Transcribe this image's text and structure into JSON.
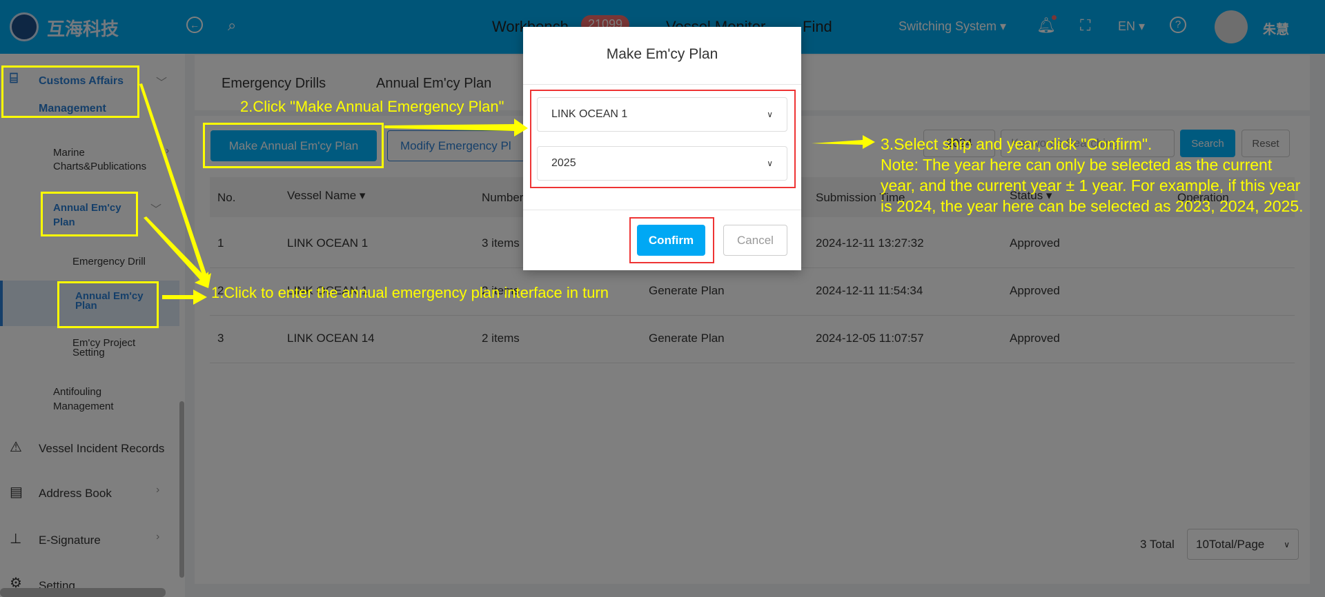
{
  "header": {
    "logo_text": "互海科技",
    "nav": [
      "Workbench",
      "Vessel Monitor",
      "Find"
    ],
    "badge": "21099",
    "switching": "Switching System ▾",
    "lang": "EN ▾",
    "user": "朱慧",
    "icons": [
      "back-icon",
      "search-icon",
      "bell-icon",
      "fullscreen-icon",
      "help-icon"
    ]
  },
  "sidebar": {
    "customs1": "Customs Affairs",
    "customs2": "Management",
    "marine1": "Marine",
    "marine2": "Charts&Publications",
    "annual1": "Annual Em'cy",
    "annual2": "Plan",
    "drill": "Emergency Drill",
    "annual_sel1": "Annual Em'cy",
    "annual_sel2": "Plan",
    "project1": "Em'cy Project",
    "project2": "Setting",
    "anti1": "Antifouling",
    "anti2": "Management",
    "incident": "Vessel Incident Records",
    "address": "Address Book",
    "esig": "E-Signature",
    "setting": "Setting"
  },
  "tabs": [
    "Emergency Drills",
    "Annual Em'cy Plan"
  ],
  "toolbar": {
    "make": "Make Annual Em'cy Plan",
    "modify": "Modify Emergency Pl",
    "year": "2024",
    "keyword_placeholder": "Keywords Searching",
    "search": "Search",
    "reset": "Reset"
  },
  "table": {
    "headers": [
      "No.",
      "Vessel Name ▾",
      "Number",
      "",
      "Submission Time",
      "Status ▾",
      "Operation"
    ],
    "rows": [
      [
        "1",
        "LINK OCEAN 1",
        "3 items",
        "",
        "2024-12-11 13:27:32",
        "Approved"
      ],
      [
        "2",
        "LINK OCEAN 1",
        "2 items",
        "Generate Plan",
        "2024-12-11 11:54:34",
        "Approved"
      ],
      [
        "3",
        "LINK OCEAN 14",
        "2 items",
        "Generate Plan",
        "2024-12-05 11:07:57",
        "Approved"
      ]
    ]
  },
  "pagination": {
    "total": "3 Total",
    "page_size": "10Total/Page"
  },
  "dialog": {
    "title": "Make Em'cy Plan",
    "vessel": "LINK OCEAN 1",
    "year": "2025",
    "confirm": "Confirm",
    "cancel": "Cancel"
  },
  "annotations": {
    "step1": "1.Click to enter the annual emergency plan interface in turn",
    "step2": "2.Click \"Make Annual Emergency Plan\"",
    "step3": [
      "3.Select ship and year, click \"Confirm\".",
      "Note: The year here can only be selected as the current",
      "year, and the current year ± 1 year. For example, if this year",
      "is 2024, the year here can be selected as 2023, 2024, 2025."
    ]
  },
  "colors": {
    "header": "#00aaf0",
    "primary": "#00a0e9",
    "annotation": "#ffff00",
    "highlight": "#ee3333"
  }
}
